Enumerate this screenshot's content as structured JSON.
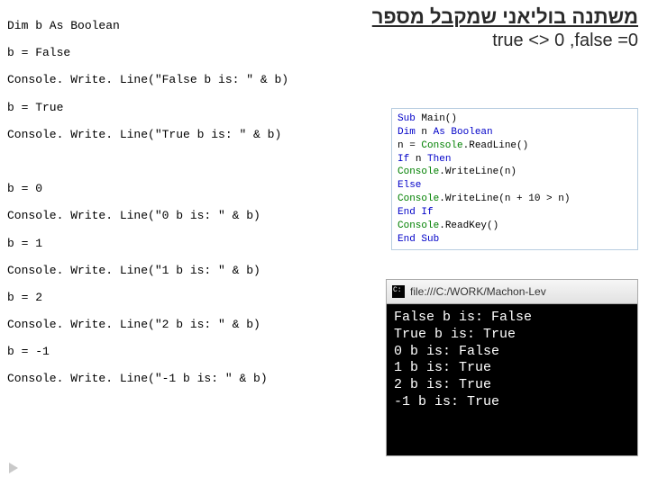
{
  "title_heb": "משתנה בוליאני שמקבל מספר",
  "subtitle": "true <> 0  ,false =0",
  "code_lines": [
    "Dim b As Boolean",
    "b = False",
    "Console. Write. Line(\"False b is: \" & b)",
    "b = True",
    "Console. Write. Line(\"True b is: \" & b)",
    "",
    "b = 0",
    "Console. Write. Line(\"0 b is: \" & b)",
    "b = 1",
    "Console. Write. Line(\"1 b is: \" & b)",
    "b = 2",
    "Console. Write. Line(\"2 b is: \" & b)",
    "b = -1",
    "Console. Write. Line(\"-1 b is: \" & b)"
  ],
  "ide_lines": [
    {
      "bl": "Sub ",
      "bk": "Main()"
    },
    {
      "bl": "    Dim ",
      "bk": "n ",
      "bl2": "As Boolean"
    },
    {
      "bk": "    n = ",
      "gn": "Console",
      "bk2": ".ReadLine()"
    },
    {
      "bl": "    If ",
      "bk": "n ",
      "bl2": "Then"
    },
    {
      "bk": "        ",
      "gn": "Console",
      "bk2": ".WriteLine(n)"
    },
    {
      "bl": "    Else"
    },
    {
      "bk": "        ",
      "gn": "Console",
      "bk2": ".WriteLine(n + 10 > n)"
    },
    {
      "bl": "    End If"
    },
    {
      "bk": "    ",
      "gn": "Console",
      "bk2": ".ReadKey()"
    },
    {
      "bl": "End Sub"
    }
  ],
  "window_title": "file:///C:/WORK/Machon-Lev",
  "console_output": [
    "False b is: False",
    "True b is: True",
    "0 b is: False",
    "1 b is: True",
    "2 b is: True",
    "-1 b is: True"
  ]
}
